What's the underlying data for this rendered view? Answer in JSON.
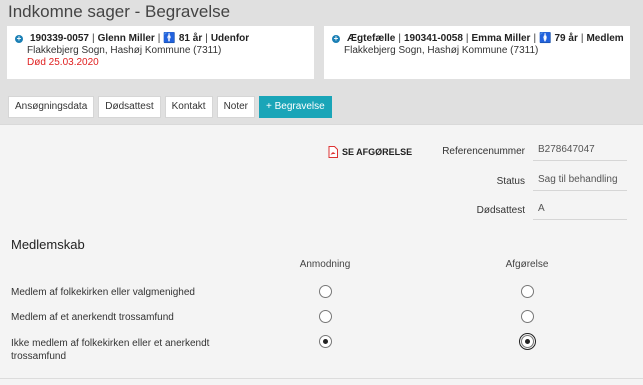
{
  "page": {
    "title": "Indkomne sager - Begravelse"
  },
  "cards": [
    {
      "id": "190339-0057",
      "name": "Glenn Miller",
      "sex": "male",
      "age": "81 år",
      "status": "Udenfor",
      "parish": "Flakkebjerg Sogn, Hashøj Kommune (7311)",
      "death": "Død 25.03.2020"
    },
    {
      "relation": "Ægtefælle",
      "id": "190341-0058",
      "name": "Emma Miller",
      "sex": "female",
      "age": "79 år",
      "status": "Medlem",
      "parish": "Flakkebjerg Sogn, Hashøj Kommune (7311)"
    }
  ],
  "tabs": [
    {
      "label": "Ansøgningsdata",
      "active": false
    },
    {
      "label": "Dødsattest",
      "active": false
    },
    {
      "label": "Kontakt",
      "active": false
    },
    {
      "label": "Noter",
      "active": false
    },
    {
      "label": "+ Begravelse",
      "active": true
    }
  ],
  "decision_link": "SE AFGØRELSE",
  "fields": [
    {
      "label": "Referencenummer",
      "value": "B278647047"
    },
    {
      "label": "Status",
      "value": "Sag til behandling"
    },
    {
      "label": "Dødsattest",
      "value": "A"
    }
  ],
  "membership": {
    "title": "Medlemskab",
    "columns": [
      "Anmodning",
      "Afgørelse"
    ],
    "rows": [
      {
        "label": "Medlem af folkekirken eller valgmenighed",
        "request": false,
        "decision": false
      },
      {
        "label": "Medlem af et anerkendt trossamfund",
        "request": false,
        "decision": false
      },
      {
        "label": "Ikke medlem af folkekirken eller et anerkendt trossamfund",
        "request": true,
        "decision": true
      }
    ]
  },
  "colors": {
    "accent": "#1aa5b8",
    "death": "#e02020",
    "male": "#1a7fb5",
    "female": "#d9534f"
  }
}
